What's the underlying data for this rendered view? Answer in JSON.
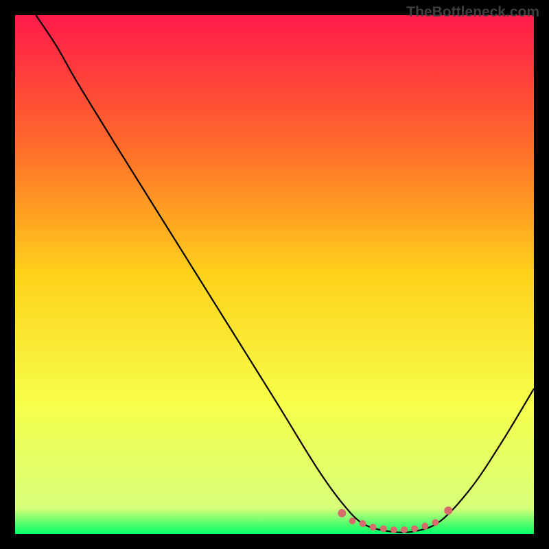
{
  "watermark": "TheBottleneck.com",
  "chart_data": {
    "type": "line",
    "title": "",
    "xlabel": "",
    "ylabel": "",
    "ylim": [
      0,
      100
    ],
    "xlim": [
      0,
      100
    ],
    "gradient_stops": [
      {
        "offset": 0,
        "color": "#ff1a4a"
      },
      {
        "offset": 25,
        "color": "#ff6a2a"
      },
      {
        "offset": 50,
        "color": "#ffd21a"
      },
      {
        "offset": 75,
        "color": "#f6ff4a"
      },
      {
        "offset": 95,
        "color": "#d8ff7a"
      },
      {
        "offset": 100,
        "color": "#00ff66"
      }
    ],
    "curve": [
      {
        "x": 4,
        "y": 100
      },
      {
        "x": 8,
        "y": 94
      },
      {
        "x": 12,
        "y": 87
      },
      {
        "x": 20,
        "y": 74
      },
      {
        "x": 30,
        "y": 58
      },
      {
        "x": 40,
        "y": 42
      },
      {
        "x": 50,
        "y": 26
      },
      {
        "x": 58,
        "y": 13
      },
      {
        "x": 63,
        "y": 6
      },
      {
        "x": 67,
        "y": 2
      },
      {
        "x": 72,
        "y": 0.5
      },
      {
        "x": 77,
        "y": 0.5
      },
      {
        "x": 82,
        "y": 2.5
      },
      {
        "x": 88,
        "y": 9
      },
      {
        "x": 94,
        "y": 18
      },
      {
        "x": 100,
        "y": 28
      }
    ],
    "markers": [
      {
        "x": 63,
        "y": 4,
        "r": 6
      },
      {
        "x": 65,
        "y": 2.5,
        "r": 5
      },
      {
        "x": 67,
        "y": 2,
        "r": 5
      },
      {
        "x": 69,
        "y": 1.3,
        "r": 5
      },
      {
        "x": 71,
        "y": 1,
        "r": 5
      },
      {
        "x": 73,
        "y": 0.8,
        "r": 5
      },
      {
        "x": 75,
        "y": 0.8,
        "r": 5
      },
      {
        "x": 77,
        "y": 1,
        "r": 5
      },
      {
        "x": 79,
        "y": 1.5,
        "r": 5
      },
      {
        "x": 81,
        "y": 2.2,
        "r": 5
      },
      {
        "x": 83.5,
        "y": 4.5,
        "r": 6
      }
    ],
    "marker_color": "#d86b6b",
    "curve_color": "#000000"
  }
}
